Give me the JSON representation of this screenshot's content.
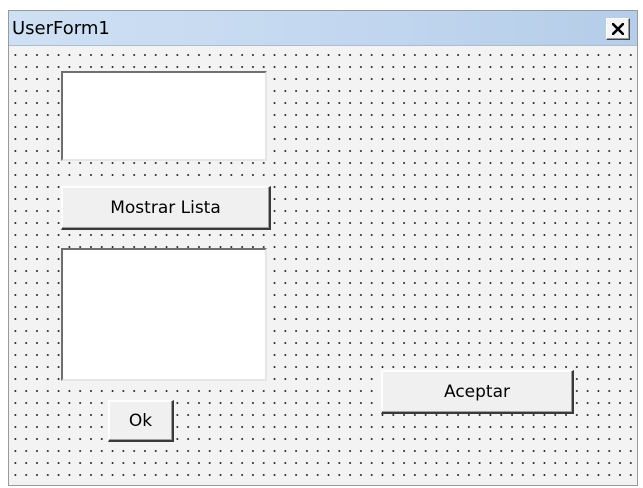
{
  "window": {
    "title": "UserForm1",
    "close_icon": "close-x-icon"
  },
  "controls": {
    "textbox1": {
      "value": ""
    },
    "listbox1": {
      "items": []
    },
    "mostrar_lista_label": "Mostrar Lista",
    "ok_label": "Ok",
    "aceptar_label": "Aceptar"
  },
  "colors": {
    "titlebar": "#c2d7ef",
    "form_background": "#f3f3f3",
    "grid_dots": "#2b2b2b"
  }
}
